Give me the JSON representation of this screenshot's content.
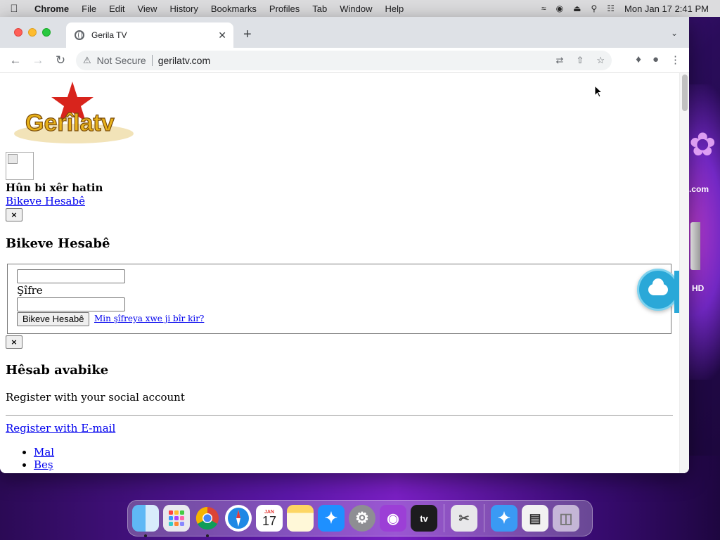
{
  "menubar": {
    "app": "Chrome",
    "items": [
      "File",
      "Edit",
      "View",
      "History",
      "Bookmarks",
      "Profiles",
      "Tab",
      "Window",
      "Help"
    ],
    "datetime": "Mon Jan 17  2:41 PM"
  },
  "browser": {
    "tab_title": "Gerila TV",
    "security": "Not Secure",
    "url": "gerilatv.com"
  },
  "page": {
    "logo_text": "Gerîlatv",
    "welcome": "Hûn bi xêr hatin",
    "login_link": "Bikeve Hesabê",
    "close_label": "×",
    "login_heading": "Bikeve Hesabê",
    "password_label": "Şîfre",
    "submit_label": "Bikeve Hesabê",
    "forgot_link": "Min şîfreya xwe ji bîr kir?",
    "register_heading": "Hêsab avabike",
    "social_text": "Register with your social account",
    "register_email": "Register with E-mail",
    "list": [
      "Mal",
      "Beş"
    ]
  },
  "desktop": {
    "network_label": ".com",
    "hd_label": "HD"
  },
  "dock": {
    "apps": [
      "Finder",
      "Launchpad",
      "Chrome",
      "Safari",
      "Calendar",
      "Notes",
      "App Store",
      "System Preferences",
      "Podcasts",
      "TV",
      "Screenshot",
      "Applications",
      "Document",
      "Trash"
    ],
    "calendar_month": "JAN",
    "calendar_day": "17",
    "tv_label": "tv"
  }
}
